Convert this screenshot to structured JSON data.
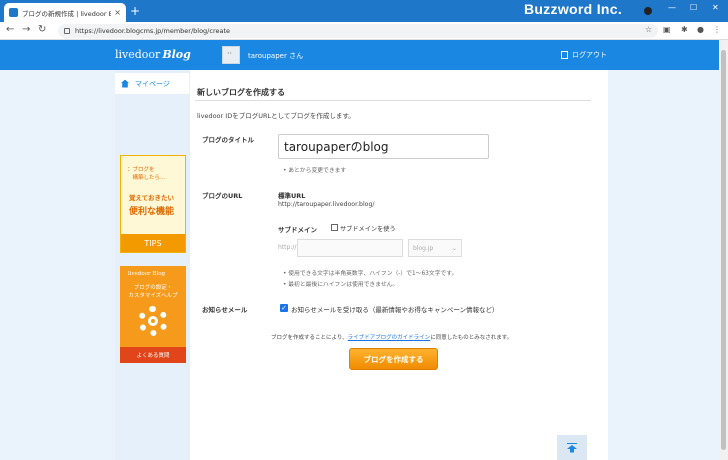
{
  "browser": {
    "tab_title": "ブログの新規作成 | livedoor Blog",
    "tab_close": "×",
    "new_tab": "+",
    "url": "https://livedoor.blogcms.jp/member/blog/create",
    "watermark": "Buzzword Inc.",
    "window_controls": [
      "—",
      "☐",
      "✕"
    ]
  },
  "header": {
    "logo_text": "livedoor",
    "logo_blog": "Blog",
    "username": "taroupaper さん",
    "logout": "ログアウト"
  },
  "sidebar": {
    "mypage": "マイページ",
    "tips_banner": {
      "line1": "：ブログを",
      "line1b": "　構築したら…",
      "line2": "覚えておきたい",
      "line3": "便利な機能",
      "footer": "TIPS"
    },
    "help_banner": {
      "logo": "livedoor Blog",
      "text1": "ブログの設定・",
      "text2": "カスタマイズヘルプ",
      "footer": "よくある質問"
    }
  },
  "main": {
    "title": "新しいブログを作成する",
    "intro": "livedoor IDをブログURLとしてブログを作成します。",
    "blog_title_label": "ブログのタイトル",
    "blog_title_value": "taroupaperのblog",
    "blog_title_note": "• あとから変更できます",
    "blog_url_label": "ブログのURL",
    "standard_url_label": "標準URL",
    "standard_url": "http://taroupaper.livedoor.blog/",
    "subdomain_label": "サブドメイン",
    "subdomain_checkbox_label": "サブドメインを使う",
    "http_prefix": "http://",
    "domain_option": "blog.jp",
    "subdomain_note1": "• 使用できる文字は半角英数字、ハイフン（-）で1〜63文字です。",
    "subdomain_note2": "• 最初と最後にハイフンは使用できません。",
    "notify_label": "お知らせメール",
    "notify_checkbox_label": "お知らせメールを受け取る（最新情報やお得なキャンペーン情報など）",
    "consent_prefix": "ブログを作成することにより、",
    "consent_link": "ライブドアブログのガイドライン",
    "consent_suffix": "に同意したものとみなされます。",
    "create_button": "ブログを作成する"
  }
}
